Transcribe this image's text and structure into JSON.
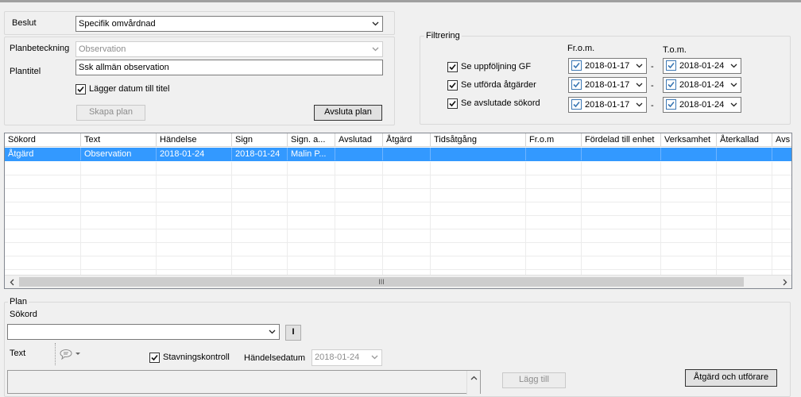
{
  "top": {
    "beslut_label": "Beslut",
    "beslut_value": "Specifik omvårdnad",
    "planbeteckning_label": "Planbeteckning",
    "planbeteckning_value": "Observation",
    "plantitel_label": "Plantitel",
    "plantitel_value": "Ssk allmän observation",
    "add_date_label": "Lägger datum till titel",
    "create_plan_label": "Skapa plan",
    "end_plan_label": "Avsluta plan"
  },
  "filter": {
    "title": "Filtrering",
    "from_header": "Fr.o.m.",
    "to_header": "T.o.m.",
    "rows": [
      {
        "label": "Se uppföljning GF",
        "from": "2018-01-17",
        "to": "2018-01-24"
      },
      {
        "label": "Se utförda åtgärder",
        "from": "2018-01-17",
        "to": "2018-01-24"
      },
      {
        "label": "Se avslutade sökord",
        "from": "2018-01-17",
        "to": "2018-01-24"
      }
    ],
    "dash": "-"
  },
  "grid": {
    "columns": [
      "Sökord",
      "Text",
      "Händelse",
      "Sign",
      "Sign. a...",
      "Avslutad",
      "Åtgärd",
      "Tidsåtgång",
      "Fr.o.m",
      "Fördelad till enhet",
      "Verksamhet",
      "Återkallad",
      "Avs"
    ],
    "rows": [
      [
        "Åtgärd",
        "Observation",
        "2018-01-24",
        "2018-01-24",
        "Malin P...",
        "",
        "",
        "",
        "",
        "",
        "",
        "",
        ""
      ]
    ],
    "scroll_grip": "III"
  },
  "plan": {
    "title": "Plan",
    "sokord_label": "Sökord",
    "sokord_value": "",
    "info_button": "I",
    "text_label": "Text",
    "spell_label": "Stavningskontroll",
    "handelsedatum_label": "Händelsedatum",
    "handelsedatum_value": "2018-01-24",
    "add_label": "Lägg till",
    "action_label": "Åtgärd och utförare"
  },
  "colors": {
    "selection": "#3399ff",
    "check_blue": "#3c78b4"
  }
}
